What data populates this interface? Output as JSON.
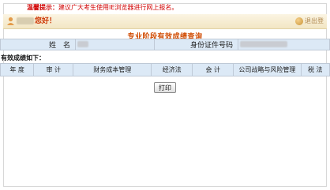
{
  "notice": {
    "prefix": "温馨提示：",
    "text": "建议广大考生使用IE浏览器进行网上报名。"
  },
  "header": {
    "greeting": "您好！",
    "logout_label": "退出登"
  },
  "query": {
    "title": "专业阶段有效成绩查询"
  },
  "info": {
    "name_label": "姓　名",
    "id_label": "身份证件号码"
  },
  "results": {
    "section_label": "有效成绩如下：",
    "columns": [
      "年 度",
      "审 计",
      "财务成本管理",
      "经济法",
      "会 计",
      "公司战略与风险管理",
      "税 法"
    ]
  },
  "actions": {
    "print_label": "打印"
  },
  "colors": {
    "notice": "#d00000",
    "title": "#d04a00",
    "table_bg": "#dce9f6",
    "greeting_bar": "#f6ecd2"
  }
}
